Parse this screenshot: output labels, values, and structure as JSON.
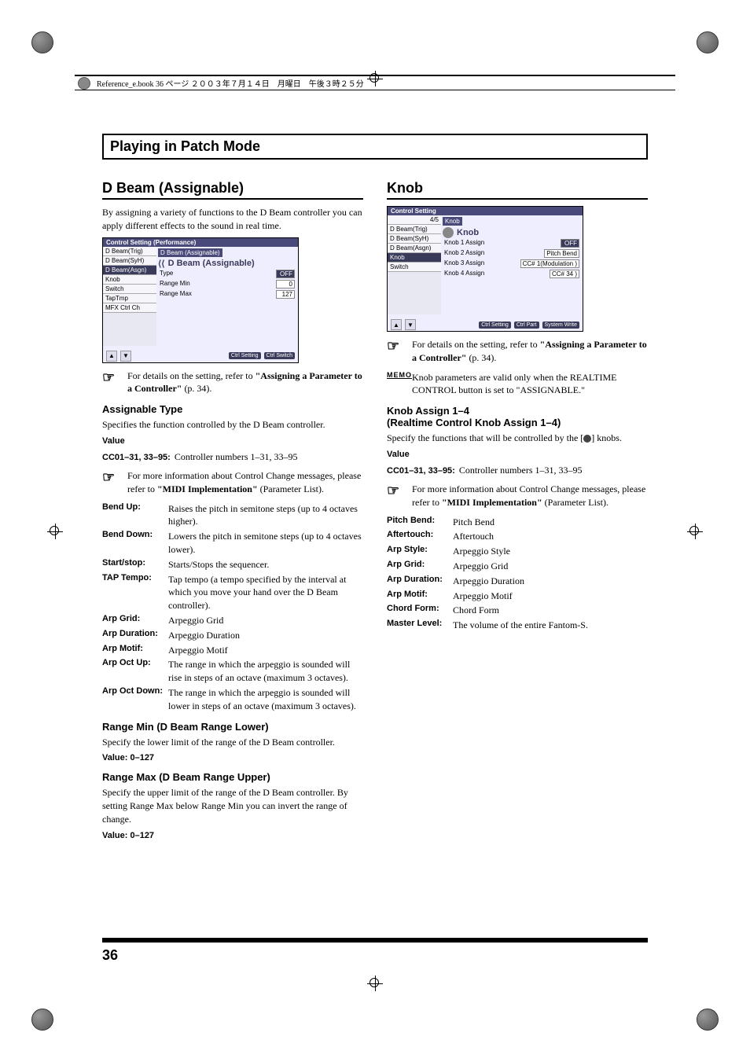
{
  "header_line": "Reference_e.book  36 ページ  ２００３年７月１４日　月曜日　午後３時２５分",
  "chapter_title": "Playing in Patch Mode",
  "page_number": "36",
  "left": {
    "h2": "D Beam (Assignable)",
    "intro": "By assigning a variety of functions to the D Beam controller you can apply different effects to the sound in real time.",
    "screenshot": {
      "title": "Control Setting (Performance)",
      "sidebar": [
        "D Beam(Trig)",
        "D Beam(SyH)",
        "D Beam(Asgn)",
        "Knob",
        "Switch",
        "TapTmp",
        "MFX Ctrl Ch"
      ],
      "crumb": "D Beam (Assignable)",
      "panel_title": "D Beam (Assignable)",
      "row1_label": "Type",
      "row1_val": "OFF",
      "row2_label": "Range Min",
      "row2_val": "0",
      "row3_label": "Range Max",
      "row3_val": "127",
      "f_btns": [
        "Ctrl Setting",
        "Ctrl Switch"
      ]
    },
    "note1_a": "For details on the setting, refer to ",
    "note1_b": "\"Assigning a Parameter to a Controller\"",
    "note1_c": " (p. 34).",
    "assignable_h3": "Assignable Type",
    "assignable_body": "Specifies the function controlled by the D Beam controller.",
    "value_label": "Value",
    "cc_line_a": "CC01–31, 33–95:",
    "cc_line_b": " Controller numbers 1–31, 33–95",
    "note2_a": "For more information about Control Change messages, please refer to ",
    "note2_b": "\"MIDI Implementation\"",
    "note2_c": " (Parameter List).",
    "defs": [
      {
        "term": "Bend Up:",
        "val": "Raises the pitch in semitone steps (up to 4 octaves higher)."
      },
      {
        "term": "Bend Down:",
        "val": "Lowers the pitch in semitone steps (up to 4 octaves lower)."
      },
      {
        "term": "Start/stop:",
        "val": "Starts/Stops the sequencer."
      },
      {
        "term": "TAP Tempo:",
        "val": "Tap tempo (a tempo specified by the interval at which you move your hand over the D Beam controller)."
      },
      {
        "term": "Arp Grid:",
        "val": "Arpeggio Grid"
      },
      {
        "term": "Arp Duration:",
        "val": "Arpeggio Duration"
      },
      {
        "term": "Arp Motif:",
        "val": "Arpeggio Motif"
      },
      {
        "term": "Arp Oct Up:",
        "val": "The range in which the arpeggio is sounded will rise in steps of an octave (maximum 3 octaves)."
      },
      {
        "term": "Arp Oct Down:",
        "val": "The range in which the arpeggio is sounded will lower in steps of an octave (maximum 3 octaves)."
      }
    ],
    "range_min_h3": "Range Min (D Beam Range Lower)",
    "range_min_body": "Specify the lower limit of the range of the D Beam controller.",
    "range_min_val": "Value: 0–127",
    "range_max_h3": "Range Max (D Beam Range Upper)",
    "range_max_body": "Specify the upper limit of the range of the D Beam controller. By setting Range Max below Range Min you can invert the range of change.",
    "range_max_val": "Value: 0–127"
  },
  "right": {
    "h2": "Knob",
    "screenshot": {
      "title": "Control Setting",
      "sidebar_top": "4/5",
      "sidebar": [
        "D Beam(Trig)",
        "D Beam(SyH)",
        "D Beam(Asgn)",
        "Knob",
        "Switch"
      ],
      "crumb": "Knob",
      "panel_title": "Knob",
      "rows": [
        {
          "label": "Knob 1 Assign",
          "val": "OFF",
          "dark": true
        },
        {
          "label": "Knob 2 Assign",
          "val": "Pitch Bend"
        },
        {
          "label": "Knob 3 Assign",
          "val": "CC# 1(Modulation  )"
        },
        {
          "label": "Knob 4 Assign",
          "val": "CC# 34             )"
        }
      ],
      "f_btns": [
        "Ctrl Setting",
        "Ctrl Part",
        "System Write"
      ]
    },
    "note1_a": "For details on the setting, refer to ",
    "note1_b": "\"Assigning a Parameter to a Controller\"",
    "note1_c": " (p. 34).",
    "memo_label": "MEMO",
    "memo_text": "Knob parameters are valid only when the REALTIME CONTROL button is set to \"ASSIGNABLE.\"",
    "knob_assign_h3a": "Knob Assign 1–4",
    "knob_assign_h3b": "(Realtime Control Knob Assign 1–4)",
    "knob_assign_body_a": "Specify the functions that will be controlled by the [",
    "knob_assign_body_b": "] knobs.",
    "value_label": "Value",
    "cc_line_a": "CC01–31, 33–95:",
    "cc_line_b": " Controller numbers 1–31, 33–95",
    "note2_a": "For more information about Control Change messages, please refer to ",
    "note2_b": "\"MIDI Implementation\"",
    "note2_c": " (Parameter List).",
    "defs": [
      {
        "term": "Pitch Bend:",
        "val": "Pitch Bend"
      },
      {
        "term": "Aftertouch:",
        "val": "Aftertouch"
      },
      {
        "term": "Arp Style:",
        "val": "Arpeggio Style"
      },
      {
        "term": "Arp Grid:",
        "val": "Arpeggio Grid"
      },
      {
        "term": "Arp Duration:",
        "val": "Arpeggio Duration"
      },
      {
        "term": "Arp Motif:",
        "val": "Arpeggio Motif"
      },
      {
        "term": "Chord Form:",
        "val": "Chord Form"
      },
      {
        "term": "Master Level:",
        "val": "The volume of the entire Fantom-S."
      }
    ]
  }
}
